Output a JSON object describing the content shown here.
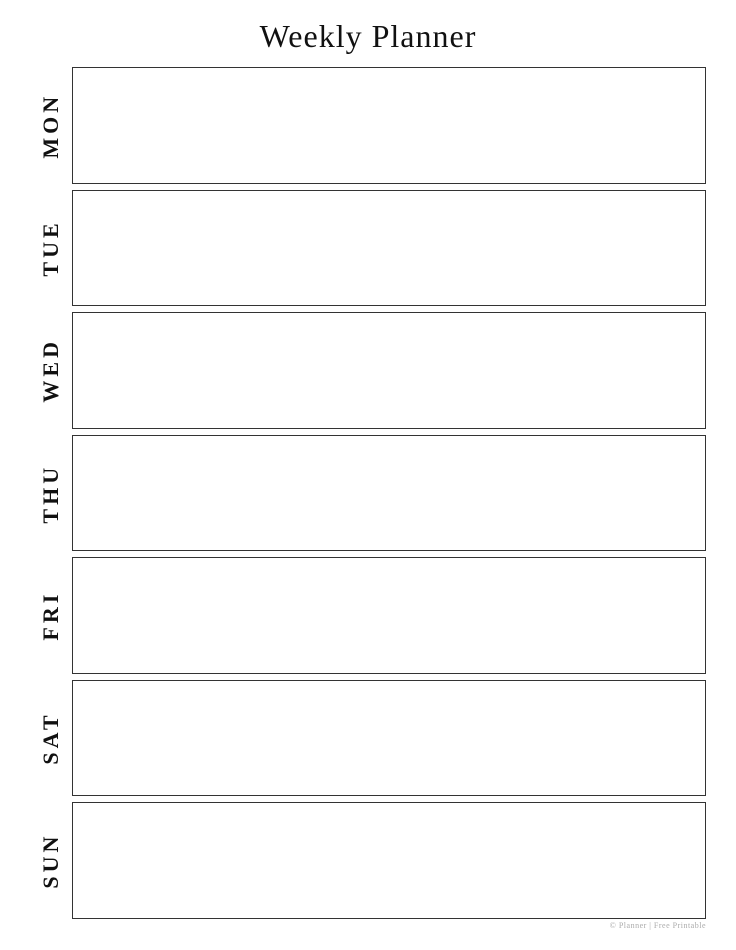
{
  "header": {
    "title": "Weekly Planner"
  },
  "days": [
    {
      "id": "monday",
      "label": "MON"
    },
    {
      "id": "tuesday",
      "label": "TUE"
    },
    {
      "id": "wednesday",
      "label": "WED"
    },
    {
      "id": "thursday",
      "label": "THU"
    },
    {
      "id": "friday",
      "label": "FRI"
    },
    {
      "id": "saturday",
      "label": "SAT"
    },
    {
      "id": "sunday",
      "label": "SUN"
    }
  ],
  "watermark": "© Planner | Free Printable"
}
